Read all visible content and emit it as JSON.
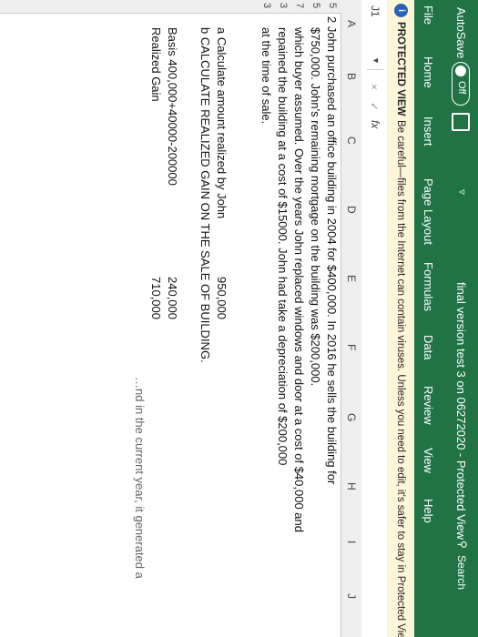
{
  "titlebar": {
    "autosave_label": "AutoSave",
    "autosave_state": "Off",
    "document_title": "final version test 3 on 06272020 - Protected View",
    "search_label": "Search"
  },
  "ribbon": {
    "tabs": [
      "File",
      "Home",
      "Insert",
      "Page Layout",
      "Formulas",
      "Data",
      "Review",
      "View",
      "Help"
    ]
  },
  "protected_view": {
    "label": "PROTECTED VIEW",
    "message": "Be careful—files from the Internet can contain viruses. Unless you need to edit, it's safer to stay in Protected View."
  },
  "formula_bar": {
    "name_box": "J1",
    "cancel_symbol": "×",
    "enter_symbol": "✓",
    "fx_symbol": "fx"
  },
  "columns": [
    "A",
    "B",
    "C",
    "D",
    "E",
    "F",
    "G",
    "H",
    "I",
    "J"
  ],
  "rows": [
    "5",
    "5",
    "7",
    "3",
    "3"
  ],
  "sheet": {
    "problem_lines": [
      "2 John purchased an office building in 2004 for $400,000. In 2016 he sells the building for",
      "$750,000. John's remaining mortgage on the building was $200,000.",
      "which buyer assumed. Over the years John replaced windows and door at a cost of $40,000 and",
      "repained the building  at a cost of $15000. John had take a depreciation of $200,000",
      "at the time of sale."
    ],
    "question_a": "a Calculate amount realized by John",
    "question_a_value": "950,000",
    "question_b": "b CALCULATE REALIZED GAIN ON THE SALE OF BUILDING.",
    "basis_label": "Basis 400,000+40000-200000",
    "basis_value": "240,000",
    "realized_label": "Realized Gain",
    "realized_value": "710,000",
    "cutoff_text": "…nd in the current year, it generated a"
  }
}
